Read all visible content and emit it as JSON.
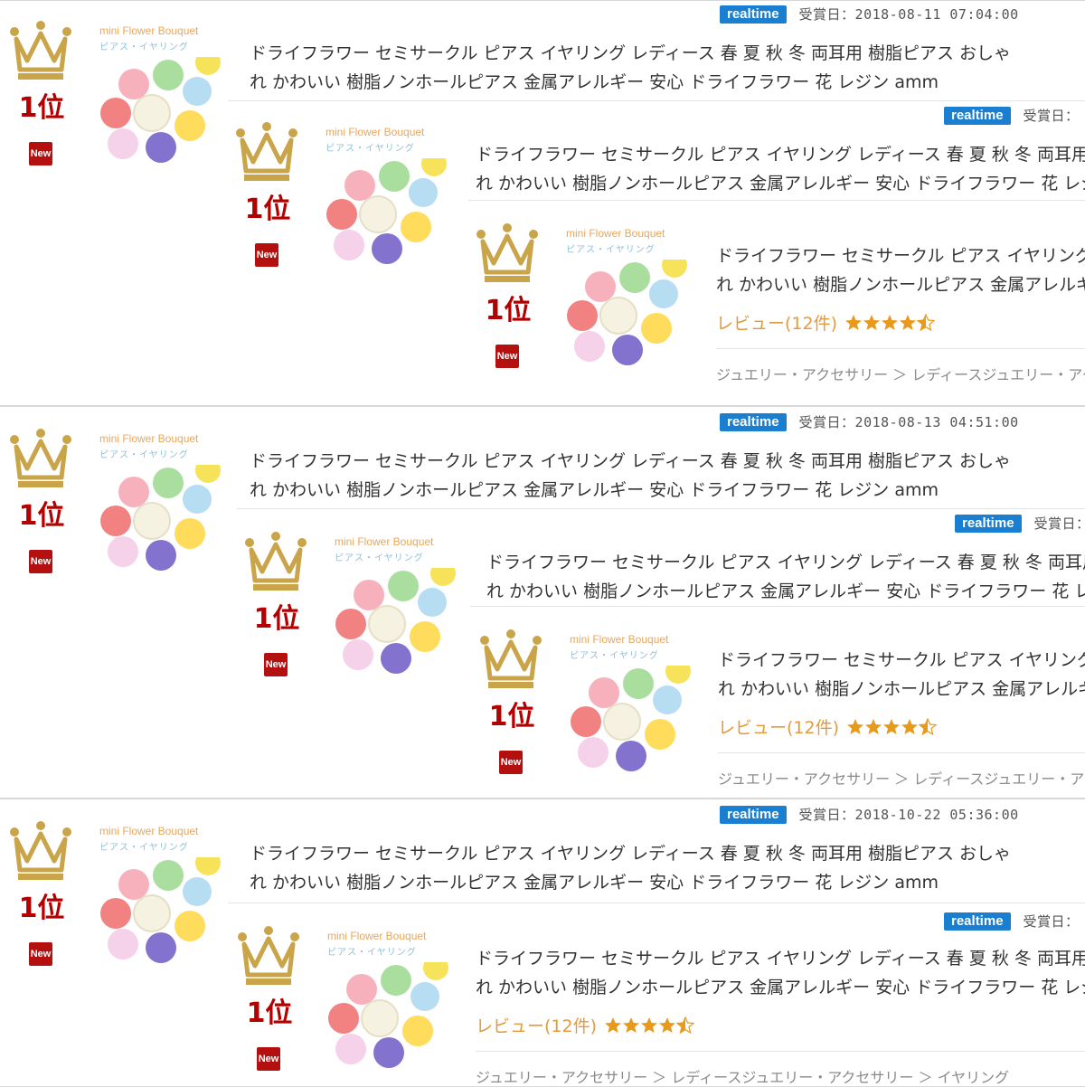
{
  "listing": {
    "product_title_line1": "ドライフラワー セミサークル ピアス イヤリング レディース 春 夏 秋 冬 両耳用 樹脂ピアス おしゃ",
    "product_title_line2": "れ かわいい 樹脂ノンホールピアス 金属アレルギー 安心 ドライフラワー 花 レジン amm",
    "rank_label": "1位",
    "new_badge": "New",
    "realtime_badge": "realtime",
    "award_date_prefix": "受賞日：",
    "thumb_title": "mini Flower Bouquet",
    "thumb_subtitle": "ピアス・イヤリング",
    "review_label": "レビュー(12件)",
    "rating": 4.5,
    "breadcrumb": "ジュエリー・アクセサリー ＞ レディースジュエリー・アクセサリー ＞ イヤリング",
    "award_entries": [
      {
        "date": "受賞日：2018-08-11 07:04:00"
      },
      {
        "date": "受賞日：2018-08-13 04:51:00"
      },
      {
        "date": "受賞日：2018-10-22 05:36:00"
      }
    ]
  },
  "colors": {
    "crown_gold": "#c9a449",
    "rank_red": "#b30000",
    "realtime_blue": "#1a7ed1",
    "review_orange": "#e49a3a",
    "star_orange": "#e89a1c"
  },
  "icons": [
    "crown-icon",
    "new-badge",
    "star-icon",
    "half-star-icon"
  ]
}
